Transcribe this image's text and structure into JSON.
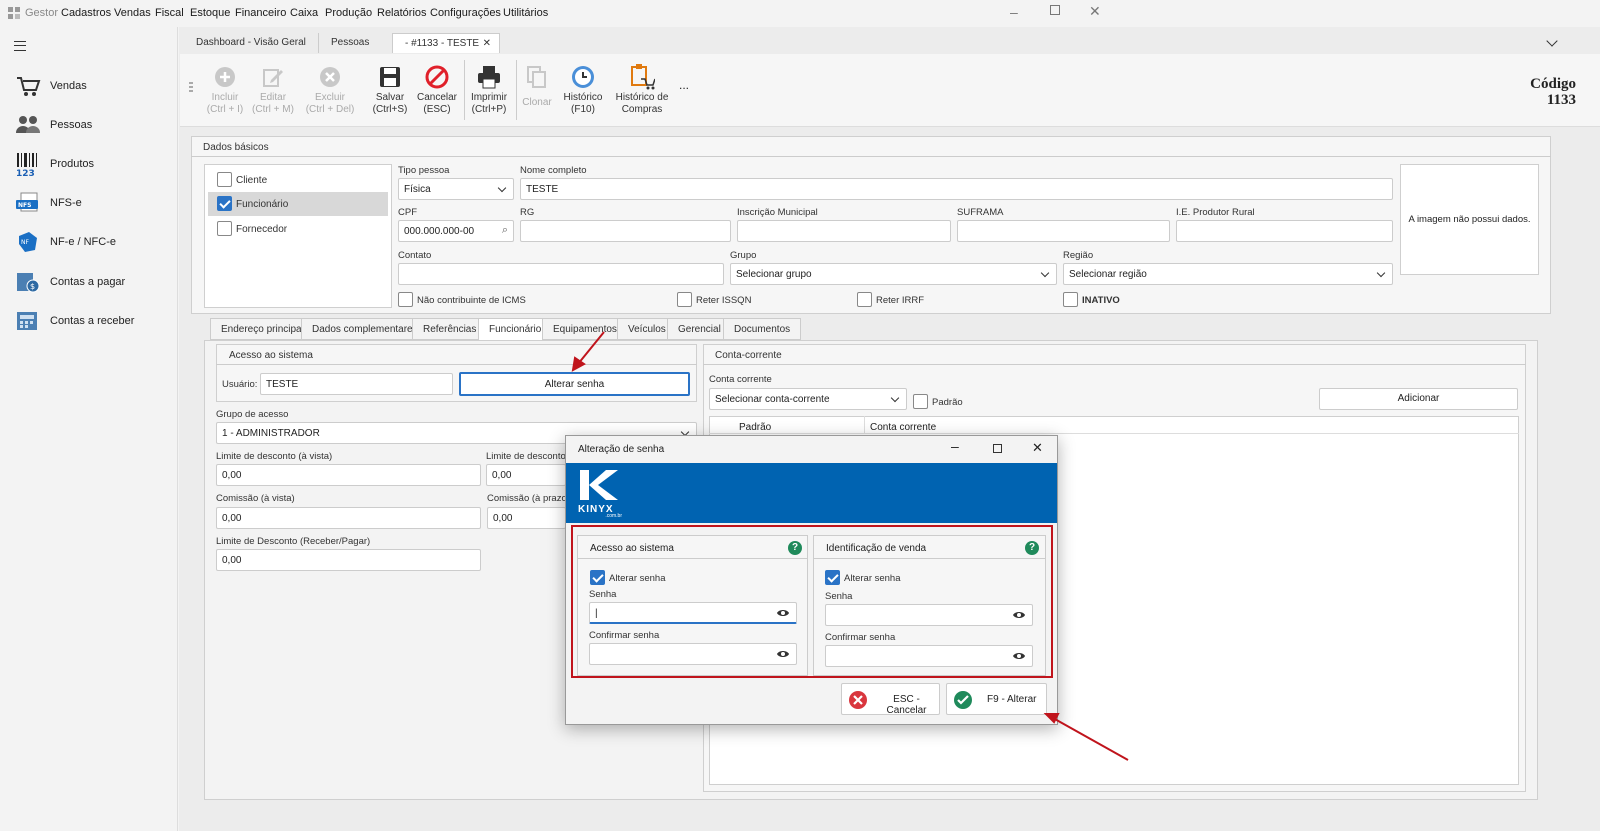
{
  "menu": {
    "brand": "Gestor",
    "items": [
      "Cadastros",
      "Vendas",
      "Fiscal",
      "Estoque",
      "Financeiro",
      "Caixa",
      "Produção",
      "Relatórios",
      "Configurações",
      "Utilitários"
    ]
  },
  "sidebar": {
    "items": [
      {
        "label": "Vendas",
        "icon": "cart-icon"
      },
      {
        "label": "Pessoas",
        "icon": "people-icon"
      },
      {
        "label": "Produtos",
        "icon": "barcode-icon"
      },
      {
        "label": "NFS-e",
        "icon": "nfse-icon"
      },
      {
        "label": "NF-e / NFC-e",
        "icon": "nfe-icon"
      },
      {
        "label": "Contas a pagar",
        "icon": "payable-icon"
      },
      {
        "label": "Contas a receber",
        "icon": "receivable-icon"
      }
    ]
  },
  "tabs": [
    {
      "label": "Dashboard - Visão Geral"
    },
    {
      "label": "Pessoas"
    },
    {
      "label": "- #1133 - TESTE"
    }
  ],
  "toolbar": {
    "incluir": "Incluir",
    "incluir_key": "(Ctrl + I)",
    "editar": "Editar",
    "editar_key": "(Ctrl + M)",
    "excluir": "Excluir",
    "excluir_key": "(Ctrl + Del)",
    "salvar": "Salvar",
    "salvar_key": "(Ctrl+S)",
    "cancelar": "Cancelar",
    "cancelar_key": "(ESC)",
    "imprimir": "Imprimir",
    "imprimir_key": "(Ctrl+P)",
    "clonar": "Clonar",
    "historico": "Histórico",
    "historico_key": "(F10)",
    "historico_compras": "Histórico de",
    "historico_compras2": "Compras",
    "more": "...",
    "codigo_label": "Código",
    "codigo_value": "1133"
  },
  "basic": {
    "title": "Dados básicos",
    "roles": [
      {
        "label": "Cliente",
        "checked": false
      },
      {
        "label": "Funcionário",
        "checked": true
      },
      {
        "label": "Fornecedor",
        "checked": false
      }
    ],
    "tipo_pessoa_label": "Tipo pessoa",
    "tipo_pessoa": "Física",
    "nome_label": "Nome completo",
    "nome": "TESTE",
    "cpf_label": "CPF",
    "cpf": "000.000.000-00",
    "rg_label": "RG",
    "im_label": "Inscrição Municipal",
    "suframa_label": "SUFRAMA",
    "ie_label": "I.E. Produtor Rural",
    "contato_label": "Contato",
    "grupo_label": "Grupo",
    "grupo": "Selecionar grupo",
    "regiao_label": "Região",
    "regiao": "Selecionar região",
    "icms": "Não contribuinte de ICMS",
    "issqn": "Reter ISSQN",
    "irrf": "Reter IRRF",
    "inativo": "INATIVO",
    "image_text": "A imagem não possui dados."
  },
  "content_tabs": [
    "Endereço principal",
    "Dados complementares",
    "Referências",
    "Funcionário",
    "Equipamentos",
    "Veículos",
    "Gerencial",
    "Documentos"
  ],
  "func": {
    "acesso_title": "Acesso ao sistema",
    "usuario_label": "Usuário:",
    "usuario": "TESTE",
    "alterar_senha_btn": "Alterar senha",
    "grupo_acesso_label": "Grupo de acesso",
    "grupo_acesso": "1 - ADMINISTRADOR",
    "lim_vista_label": "Limite de desconto (à vista)",
    "lim_vista": "0,00",
    "lim_prazo_label": "Limite de desconto (",
    "lim_prazo": "0,00",
    "com_vista_label": "Comissão (à vista)",
    "com_vista": "0,00",
    "com_prazo_label": "Comissão (à prazo)",
    "com_prazo": "0,00",
    "lim_receber_label": "Limite de Desconto (Receber/Pagar)",
    "lim_receber": "0,00"
  },
  "conta": {
    "title": "Conta-corrente",
    "label": "Conta corrente",
    "select": "Selecionar conta-corrente",
    "padrao": "Padrão",
    "adicionar": "Adicionar",
    "col_padrao": "Padrão",
    "col_conta": "Conta corrente"
  },
  "dialog": {
    "title": "Alteração de senha",
    "logo": "KINYX",
    "logo_sub": ".com.br",
    "left": {
      "title": "Acesso ao sistema",
      "alterar": "Alterar senha",
      "senha": "Senha",
      "confirmar": "Confirmar senha",
      "senha_value": "|"
    },
    "right": {
      "title": "Identificação de venda",
      "alterar": "Alterar senha",
      "senha": "Senha",
      "confirmar": "Confirmar senha"
    },
    "cancel": "ESC - Cancelar",
    "ok": "F9 - Alterar"
  },
  "colors": {
    "brand_blue": "#0063b1",
    "annotation_red": "#c0141c",
    "check_blue": "#2a73c6",
    "cancel_red": "#d9363e",
    "ok_green": "#1f8a5b"
  }
}
